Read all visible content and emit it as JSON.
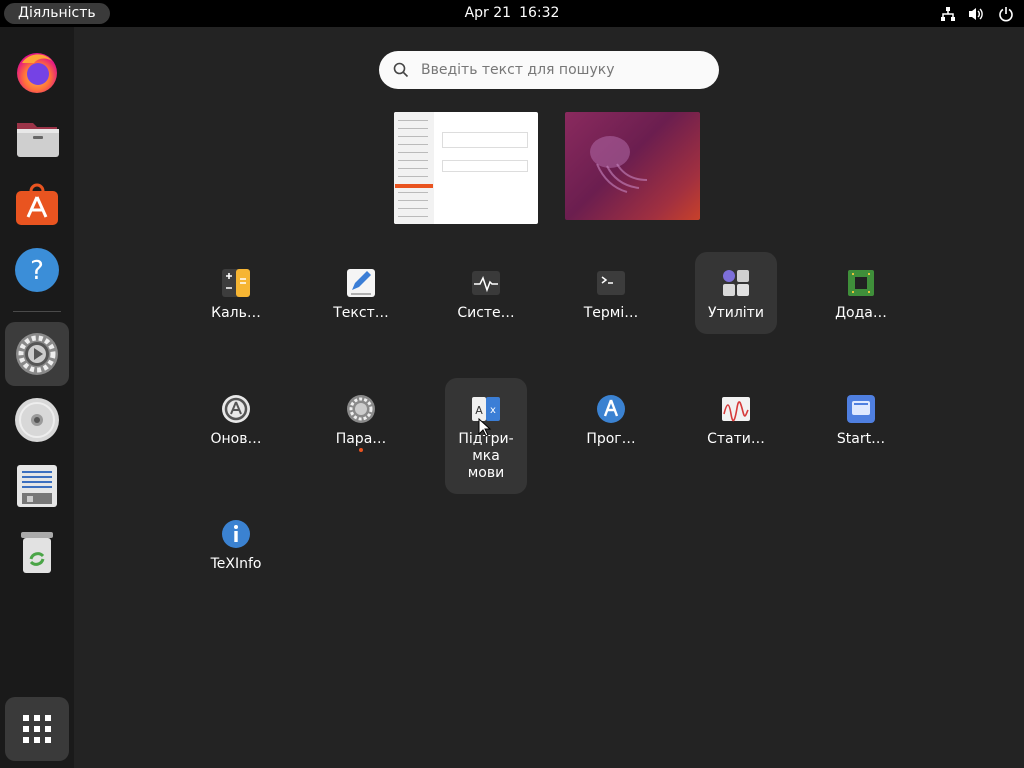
{
  "topbar": {
    "activities_label": "Діяльність",
    "date": "Apr 21",
    "time": "16:32",
    "tray": [
      "network-icon",
      "volume-icon",
      "power-icon"
    ]
  },
  "dock": {
    "items": [
      "firefox-icon",
      "files-icon",
      "app-center-icon",
      "help-icon",
      "settings-icon",
      "disc-icon",
      "text-document-icon",
      "trash-icon"
    ],
    "show_apps": "show-apps-grid-icon"
  },
  "search": {
    "placeholder": "Введіть текст для пошуку"
  },
  "apps": [
    {
      "label": "Каль…",
      "icon": "calculator-icon"
    },
    {
      "label": "Текст…",
      "icon": "text-editor-icon"
    },
    {
      "label": "Систе…",
      "icon": "system-monitor-icon"
    },
    {
      "label": "Термі…",
      "icon": "terminal-icon"
    },
    {
      "label": "Утиліти",
      "icon": "utilities-folder-icon"
    },
    {
      "label": "Дода…",
      "icon": "additional-drivers-icon"
    },
    {
      "label": "Онов…",
      "icon": "software-updater-icon"
    },
    {
      "label": "Пара…",
      "icon": "settings-icon"
    },
    {
      "label": "Підтри-\nмка\nмови",
      "icon": "language-support-icon"
    },
    {
      "label": "Прог…",
      "icon": "software-properties-icon"
    },
    {
      "label": "Стати…",
      "icon": "power-statistics-icon"
    },
    {
      "label": "Start…",
      "icon": "startup-disk-creator-icon"
    },
    {
      "label": "TeXInfo",
      "icon": "info-icon"
    }
  ],
  "colors": {
    "accent": "#e95420",
    "background": "#232323",
    "dock": "#1a1a1a",
    "topbar": "#000000"
  }
}
